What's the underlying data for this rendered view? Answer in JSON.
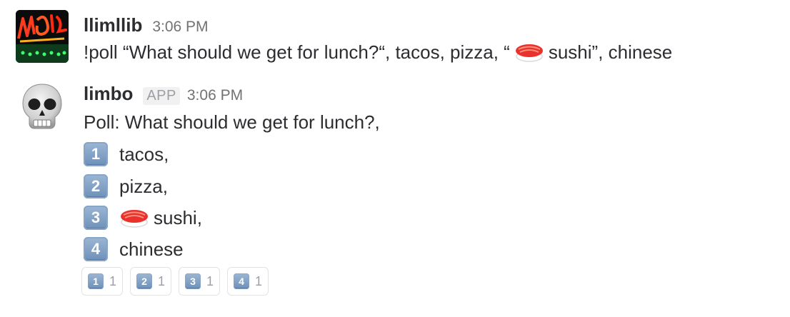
{
  "messages": [
    {
      "username": "llimllib",
      "timestamp": "3:06 PM",
      "text_before_sushi": "!poll “What should we get for lunch?“, tacos, pizza, “",
      "text_after_sushi": "sushi”, chinese"
    },
    {
      "username": "limbo",
      "badge": "APP",
      "timestamp": "3:06 PM",
      "poll_title": "Poll: What should we get for lunch?,",
      "options": [
        {
          "number": "1",
          "label": "tacos,"
        },
        {
          "number": "2",
          "label": "pizza,"
        },
        {
          "number": "3",
          "label": "sushi,"
        },
        {
          "number": "4",
          "label": "chinese"
        }
      ],
      "reactions": [
        {
          "emoji": "1",
          "count": "1"
        },
        {
          "emoji": "2",
          "count": "1"
        },
        {
          "emoji": "3",
          "count": "1"
        },
        {
          "emoji": "4",
          "count": "1"
        }
      ]
    }
  ],
  "icons": {
    "avatar_1": "neon-sign-avatar",
    "avatar_2": "skull-icon",
    "emoji_sushi": "sushi-icon",
    "emoji_keycap": "keycap-number-icon"
  },
  "colors": {
    "text": "#2c2d30",
    "timestamp": "#717274",
    "badge_text": "#9e9ea6",
    "badge_bg": "#f1f1f2",
    "keycap": "#7d9ec4",
    "reaction_border": "#e3e3e5"
  }
}
